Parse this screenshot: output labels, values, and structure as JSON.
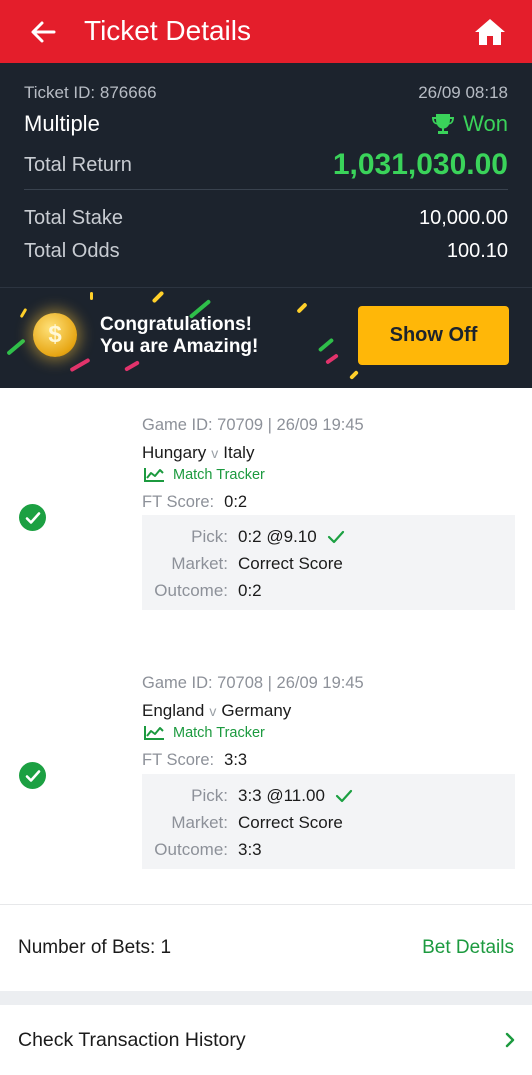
{
  "header": {
    "title": "Ticket Details"
  },
  "summary": {
    "ticket_id": "Ticket ID: 876666",
    "ticket_time": "26/09 08:18",
    "bet_type": "Multiple",
    "status": "Won",
    "total_return_label": "Total Return",
    "total_return_value": "1,031,030.00",
    "total_stake_label": "Total Stake",
    "total_stake_value": "10,000.00",
    "total_odds_label": "Total Odds",
    "total_odds_value": "100.10"
  },
  "banner": {
    "line1": "Congratulations!",
    "line2": "You are Amazing!",
    "button_label": "Show Off"
  },
  "legs": [
    {
      "meta": "Game ID: 70709 | 26/09 19:45",
      "home": "Hungary",
      "vs": "v",
      "away": "Italy",
      "tracker_label": "Match Tracker",
      "ft_label": "FT Score:",
      "ft_value": "0:2",
      "pick_label": "Pick:",
      "pick_value": "0:2 @9.10",
      "market_label": "Market:",
      "market_value": "Correct Score",
      "outcome_label": "Outcome:",
      "outcome_value": "0:2"
    },
    {
      "meta": "Game ID: 70708 | 26/09 19:45",
      "home": "England",
      "vs": "v",
      "away": "Germany",
      "tracker_label": "Match Tracker",
      "ft_label": "FT Score:",
      "ft_value": "3:3",
      "pick_label": "Pick:",
      "pick_value": "3:3 @11.00",
      "market_label": "Market:",
      "market_value": "Correct Score",
      "outcome_label": "Outcome:",
      "outcome_value": "3:3"
    }
  ],
  "footer": {
    "bets_count": "Number of Bets: 1",
    "bet_details_link": "Bet Details",
    "history_label": "Check Transaction History"
  },
  "colors": {
    "brand_red": "#e41e2b",
    "won_green": "#3ad35a",
    "link_green": "#1c9a3f",
    "button_yellow": "#ffb708",
    "panel_dark": "#1c232d"
  },
  "icons": [
    "back-arrow-icon",
    "home-icon",
    "trophy-icon",
    "coin-icon",
    "check-circle-icon",
    "chart-line-icon",
    "checkmark-icon",
    "chevron-right-icon"
  ]
}
